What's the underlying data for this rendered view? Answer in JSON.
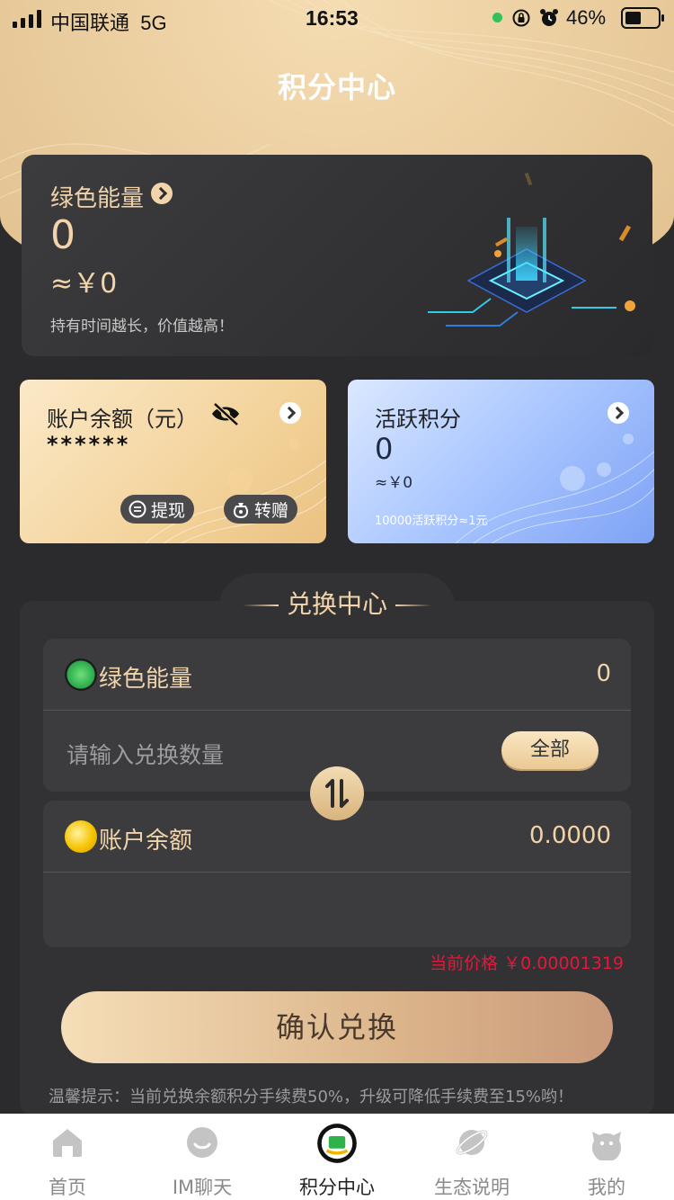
{
  "status_bar": {
    "carrier": "中国联通",
    "network": "5G",
    "time": "16:53",
    "battery": "46%"
  },
  "header": {
    "title": "积分中心"
  },
  "energy_card": {
    "title": "绿色能量",
    "value": "0",
    "cny_value": "≈￥0",
    "hint": "持有时间越长，价值越高！",
    "icon": "chevron-right-icon"
  },
  "balance_card": {
    "title": "账户余额（元）",
    "masked_value": "******",
    "withdraw_label": "提现",
    "gift_label": "转赠"
  },
  "active_card": {
    "title": "活跃积分",
    "value": "0",
    "cny_value": "≈￥0",
    "rule": "10000活跃积分≈1元"
  },
  "exchange": {
    "title": "兑换中心",
    "from_label": "绿色能量",
    "from_value": "0",
    "input_placeholder": "请输入兑换数量",
    "all_label": "全部",
    "to_label": "账户余额",
    "to_value": "0.0000",
    "price_label": "当前价格 ￥0.00001319",
    "confirm_label": "确认兑换",
    "tip": "温馨提示：当前兑换余额积分手续费50%，升级可降低手续费至15%哟！"
  },
  "tabs": [
    {
      "label": "首页",
      "icon": "home-icon",
      "active": false
    },
    {
      "label": "IM聊天",
      "icon": "chat-icon",
      "active": false
    },
    {
      "label": "积分中心",
      "icon": "points-icon",
      "active": true
    },
    {
      "label": "生态说明",
      "icon": "planet-icon",
      "active": false
    },
    {
      "label": "我的",
      "icon": "profile-icon",
      "active": false
    }
  ],
  "colors": {
    "gold": "#f1d4a9",
    "dark_bg": "#2b2b2d",
    "price_red": "#e3183b"
  }
}
